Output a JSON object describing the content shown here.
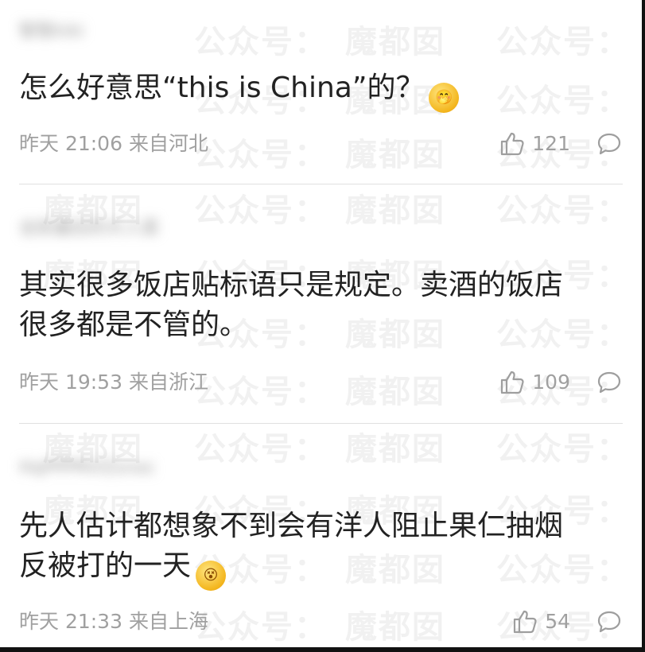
{
  "watermark": {
    "text_a": "公众号：",
    "text_b": "魔都囡"
  },
  "comments": [
    {
      "username": "智智kiki",
      "text_lines": [
        "怎么好意思“this is China”的？"
      ],
      "emoji": "🤭",
      "time": "昨天 21:06",
      "location": "来自河北",
      "likes": "121"
    },
    {
      "username": "全民最后的大人菜",
      "text_lines": [
        "其实很多饭店贴标语只是规定。卖酒的饭店",
        "很多都是不管的。"
      ],
      "emoji": "",
      "time": "昨天 19:53",
      "location": "来自浙江",
      "likes": "109"
    },
    {
      "username": "HqPPPRVlZsnoc",
      "text_lines": [
        "先人估计都想象不到会有洋人阻止果仁抽烟",
        "反被打的一天"
      ],
      "emoji": "😵",
      "time": "昨天 21:33",
      "location": "来自上海",
      "likes": "54"
    }
  ],
  "icons": {
    "like": "thumbs-up-icon",
    "comment": "comment-bubble-icon"
  },
  "colors": {
    "text": "#222222",
    "meta": "#a0a0a0",
    "divider": "#e0e0e0",
    "frame_border": "#111111"
  }
}
